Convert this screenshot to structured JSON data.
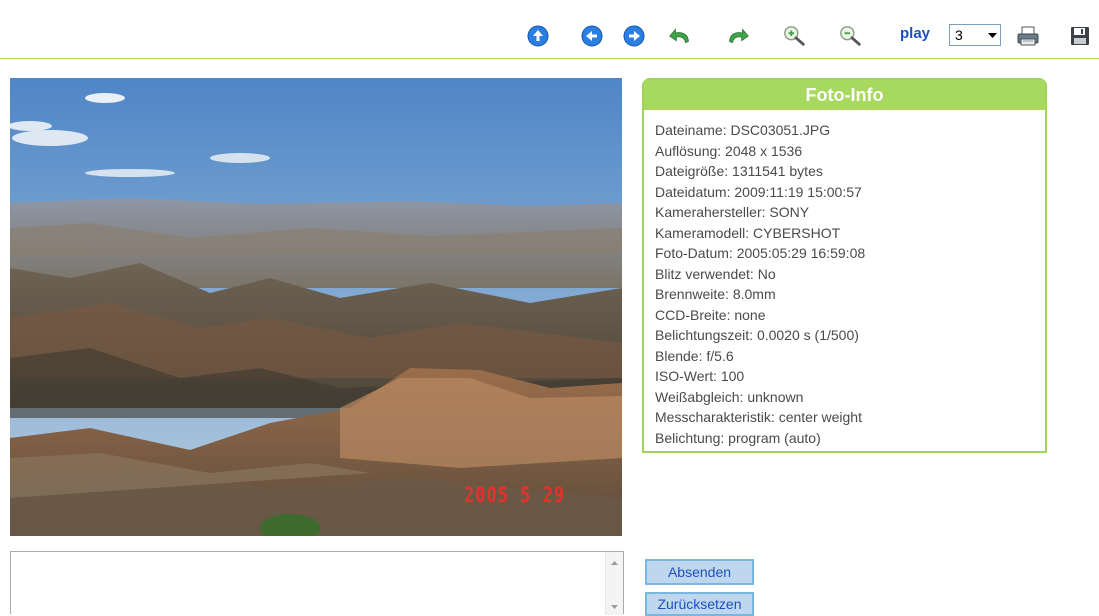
{
  "toolbar": {
    "icons": [
      "up-arrow-icon",
      "left-arrow-icon",
      "right-arrow-icon",
      "rotate-left-icon",
      "rotate-right-icon",
      "zoom-in-icon",
      "zoom-out-icon"
    ],
    "play_label": "play",
    "play_count": "3",
    "print_icon": "printer-icon",
    "save_icon": "floppy-disk-icon"
  },
  "photo": {
    "date_stamp": "2005  5 29"
  },
  "info": {
    "title": "Foto-Info",
    "lines": [
      "Dateiname: DSC03051.JPG",
      "Auflösung: 2048 x 1536",
      "Dateigröße: 1311541 bytes",
      "Dateidatum: 2009:11:19 15:00:57",
      "Kamerahersteller: SONY",
      "Kameramodell: CYBERSHOT",
      "Foto-Datum: 2005:05:29 16:59:08",
      "Blitz verwendet: No",
      "Brennweite: 8.0mm",
      "CCD-Breite: none",
      "Belichtungszeit: 0.0020 s (1/500)",
      "Blende: f/5.6",
      "ISO-Wert: 100",
      "Weißabgleich: unknown",
      "Messcharakteristik: center weight",
      "Belichtung: program (auto)"
    ]
  },
  "form": {
    "comment_value": "",
    "send_label": "Absenden",
    "reset_label": "Zurücksetzen"
  },
  "colors": {
    "accent_green": "#a6d95d",
    "link_blue": "#1d4fc4"
  }
}
